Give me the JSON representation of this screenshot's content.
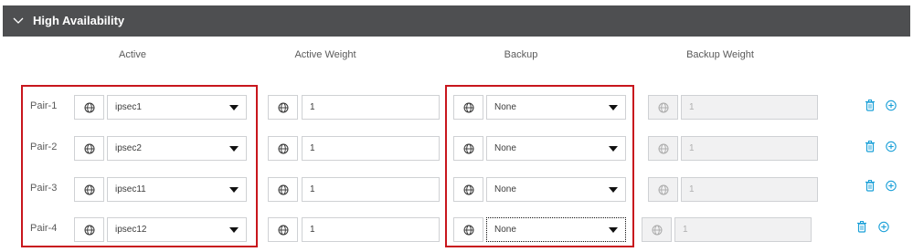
{
  "section": {
    "title": "High Availability",
    "chevron_icon": "chevron-down-icon"
  },
  "columns": {
    "active": "Active",
    "active_weight": "Active Weight",
    "backup": "Backup",
    "backup_weight": "Backup Weight"
  },
  "pairs": [
    {
      "label": "Pair-1",
      "active": "ipsec1",
      "active_weight": "1",
      "backup": "None",
      "backup_weight": "1"
    },
    {
      "label": "Pair-2",
      "active": "ipsec2",
      "active_weight": "1",
      "backup": "None",
      "backup_weight": "1"
    },
    {
      "label": "Pair-3",
      "active": "ipsec11",
      "active_weight": "1",
      "backup": "None",
      "backup_weight": "1"
    },
    {
      "label": "Pair-4",
      "active": "ipsec12",
      "active_weight": "1",
      "backup": "None",
      "backup_weight": "1"
    }
  ],
  "colors": {
    "header_bg": "#4e4f51",
    "highlight": "#c8161d",
    "action_icon": "#1ba0d8"
  },
  "icons": {
    "field_icon": "globe-icon",
    "delete_icon": "trash-icon",
    "add_icon": "plus-circle-icon"
  }
}
